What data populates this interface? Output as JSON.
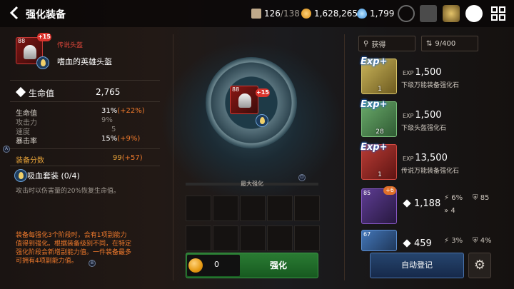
{
  "header": {
    "title": "强化装备",
    "stamina": "126",
    "stamina_max": "/138",
    "gold": "1,628,265",
    "crystals": "1,799"
  },
  "item": {
    "level": "88",
    "plus": "+15",
    "rarity_label": "传说头盔",
    "name": "嗜血的英雄头盔",
    "main_stat_label": "生命值",
    "main_stat_value": "2,765",
    "stats": [
      {
        "name": "生命值",
        "value": "31%",
        "bonus": "(+22%)"
      },
      {
        "name": "攻击力",
        "value": "9%",
        "bonus": ""
      },
      {
        "name": "速度",
        "value": "5",
        "bonus": ""
      },
      {
        "name": "暴击率",
        "value": "15%",
        "bonus": "(+9%)"
      }
    ],
    "score_label": "装备分数",
    "score_value": "99",
    "score_bonus": "(+57)",
    "set_name": "吸血套装",
    "set_count": "(0/4)",
    "set_desc": "攻击时以伤害量的20%恢复生命值。",
    "note_line1": "装备每强化3个阶段时，会有1项副能力",
    "note_line2": "值得到强化。根据装备级别不同，在特定",
    "note_line3": "强化阶段会新增副能力值。一件装备最多",
    "note_line4": "可拥有4项副能力值。"
  },
  "center": {
    "slot_level": "88",
    "slot_plus": "+15",
    "max_label": "最大强化",
    "cost": "0",
    "enhance_label": "强化"
  },
  "right": {
    "filter_label": "获得",
    "capacity": "9/400",
    "materials": [
      {
        "badge": "Exp+",
        "count": "1",
        "value": "1,500",
        "desc": "下级万能装备强化石"
      },
      {
        "badge": "Exp+",
        "count": "28",
        "value": "1,500",
        "desc": "下级头盔强化石"
      },
      {
        "badge": "Exp+",
        "count": "1",
        "value": "13,500",
        "desc": "传说万能装备强化石"
      }
    ],
    "gear": [
      {
        "level": "85",
        "plus": "+6",
        "value": "1,188",
        "sub1": "6%",
        "sub2": "85",
        "sub3": "4"
      },
      {
        "level": "67",
        "value": "459",
        "sub1": "3%",
        "sub2": "4%"
      }
    ],
    "auto_label": "自动登记"
  },
  "colors": {
    "accent_orange": "#f07a2c",
    "legend_red": "#e0473b",
    "score_gold": "#e7a339",
    "enhance_green": "#1f6a28",
    "auto_blue": "#1c355c"
  }
}
